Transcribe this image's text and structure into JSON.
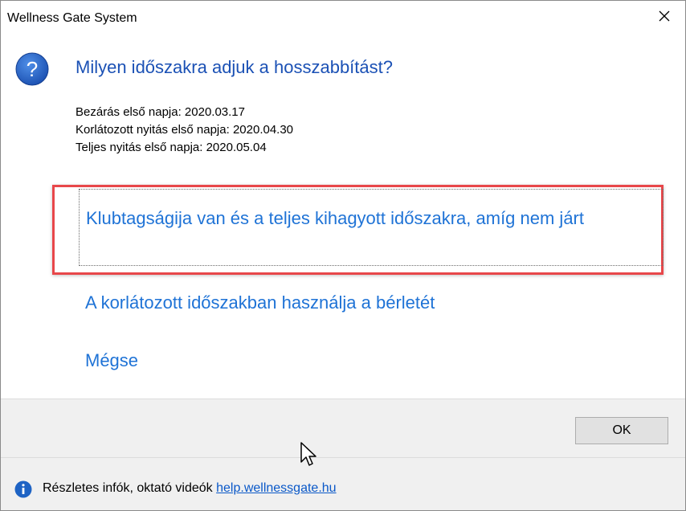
{
  "window": {
    "title": "Wellness Gate System"
  },
  "dialog": {
    "main_instruction": "Milyen időszakra adjuk a hosszabbítást?",
    "content_lines": [
      "Bezárás első napja: 2020.03.17",
      "Korlátozott nyitás első napja: 2020.04.30",
      "Teljes nyitás első napja: 2020.05.04"
    ],
    "command_links": [
      "Klubtagságija van és a teljes kihagyott időszakra, amíg nem járt",
      "A korlátozott időszakban használja a bérletét",
      "Mégse"
    ],
    "ok_label": "OK"
  },
  "footer": {
    "text": "Részletes infók, oktató videók",
    "link": "help.wellnessgate.hu"
  },
  "colors": {
    "main_instruction": "#1b51b5",
    "command_link": "#1f73d6",
    "highlight": "#e8474a",
    "info_icon": "#1e63c4"
  }
}
